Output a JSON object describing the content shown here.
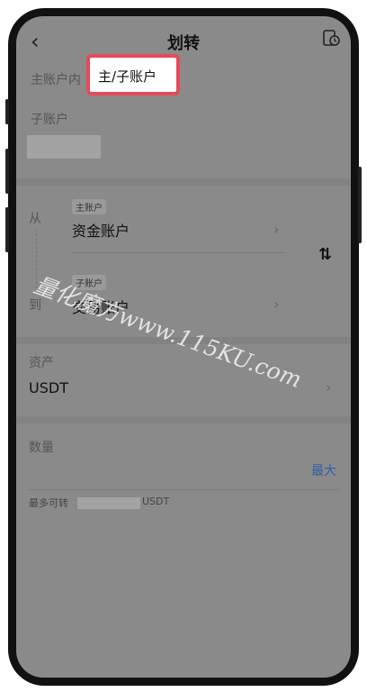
{
  "header": {
    "title": "划转",
    "back_icon": "chevron-left-icon",
    "history_icon": "transfer-history-icon"
  },
  "main_account": {
    "label": "主账户内",
    "highlight": "主/子账户"
  },
  "sub_account": {
    "label": "子账户"
  },
  "transfer": {
    "from_label": "从",
    "to_label": "到",
    "from_tag": "主账户",
    "from_account": "资金账户",
    "to_tag": "子账户",
    "to_account": "交易账户",
    "swap_glyph": "⇅"
  },
  "asset": {
    "label": "资产",
    "value": "USDT"
  },
  "amount": {
    "label": "数量",
    "max": "最大"
  },
  "available": {
    "label": "最多可转",
    "unit": "USDT"
  },
  "watermark": {
    "text": "量化魔方www.115KU.com"
  }
}
